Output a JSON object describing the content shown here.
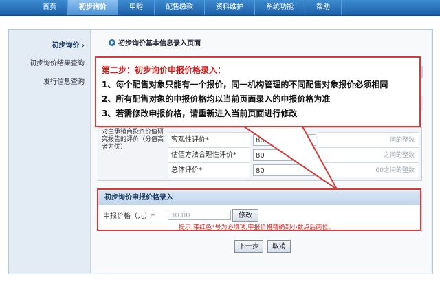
{
  "nav": {
    "items": [
      "首页",
      "初步询价",
      "申购",
      "配售缴款",
      "资料维护",
      "系统功能",
      "帮助"
    ],
    "active_index": 1
  },
  "sidebar": {
    "items": [
      "初步询价",
      "初步询价结果查询",
      "发行信息查询"
    ],
    "active_index": 0
  },
  "page": {
    "title": "初步询价基本信息录入页面"
  },
  "callout": {
    "heading": "第二步：初步询价申报价格录入：",
    "lines": [
      "1、每个配售对象只能有一个报价，同一机构管理的不同配售对象报价必须相同",
      "2、所有配售对象的申报价格均以当前页面录入的申报价格为准",
      "3、若需修改申报价格，请重新进入当前页面进行修改"
    ]
  },
  "evaluation": {
    "label": "对主承销商投资价值研究报告的评价（分值高者为优）",
    "rows": [
      {
        "label": "客观性评价*",
        "value": "80",
        "hint": "间的整数"
      },
      {
        "label": "估值方法合理性评价*",
        "value": "80",
        "hint": "之间的整数"
      },
      {
        "label": "总体评价*",
        "value": "80",
        "hint": "00之间的整数"
      }
    ]
  },
  "price_entry": {
    "header": "初步询价申报价格录入",
    "label": "申报价格（元）*",
    "value": "30.00",
    "modify_button": "修改",
    "tip": "提示:带红色*号为必填项,申报价格精确到小数点后两位。"
  },
  "actions": {
    "next": "下一步",
    "cancel": "取消"
  },
  "colors": {
    "accent": "#1c5fa8",
    "callout_border": "#d83a3a",
    "warning": "#d22222"
  }
}
